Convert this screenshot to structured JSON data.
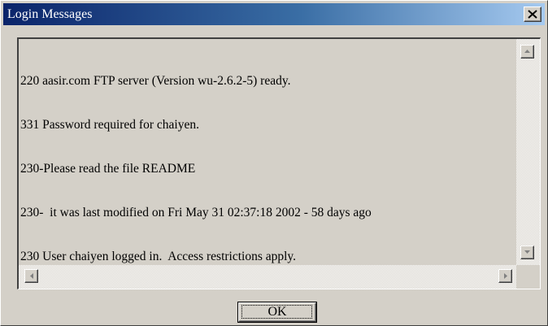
{
  "window": {
    "title": "Login Messages",
    "close_icon": "close-icon",
    "colors": {
      "titlebar_start": "#0a246a",
      "titlebar_end": "#a6caf0",
      "face": "#d4d0c8"
    }
  },
  "messages": {
    "lines": [
      "220 aasir.com FTP server (Version wu-2.6.2-5) ready.",
      "331 Password required for chaiyen.",
      "230-Please read the file README",
      "230-  it was last modified on Fri May 31 02:37:18 2002 - 58 days ago",
      "230 User chaiyen logged in.  Access restrictions apply."
    ]
  },
  "scrollbars": {
    "up_icon": "arrow-up-icon",
    "down_icon": "arrow-down-icon",
    "left_icon": "arrow-left-icon",
    "right_icon": "arrow-right-icon"
  },
  "buttons": {
    "ok_label": "OK"
  }
}
